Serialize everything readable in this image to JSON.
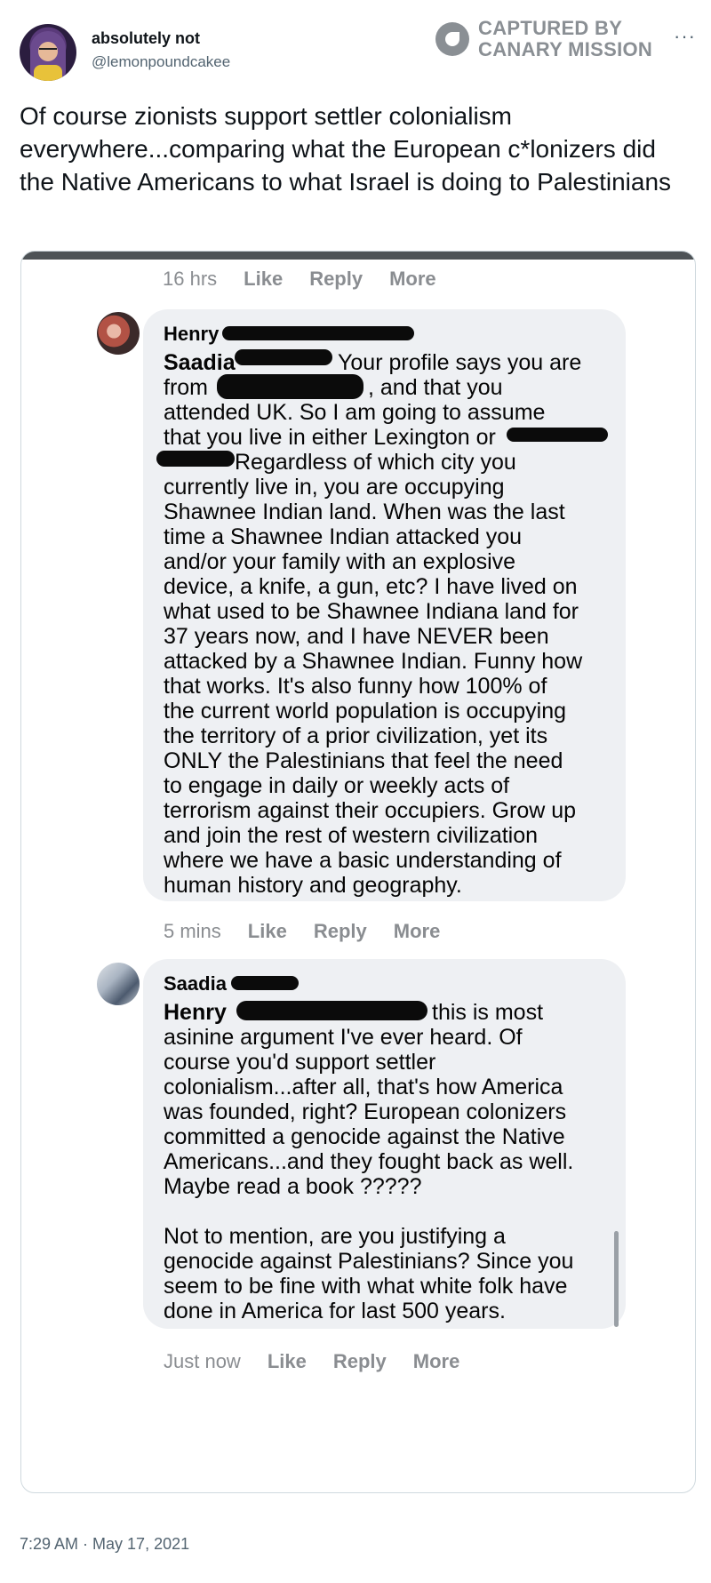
{
  "tweet": {
    "display_name": "absolutely not",
    "handle": "@lemonpoundcakee",
    "watermark": "CAPTURED BY\nCANARY MISSION",
    "watermark_line1": "CAPTURED BY",
    "watermark_line2": "CANARY MISSION",
    "more_icon": "more-dots-icon",
    "text": "Of course zionists support settler colonialism everywhere...comparing what the European c*lonizers did the Native Americans to what Israel is doing to Palestinians",
    "timestamp": "7:29 AM · May 17, 2021"
  },
  "embedded_thread": {
    "top_actions": {
      "time": "16 hrs",
      "like": "Like",
      "reply": "Reply",
      "more": "More"
    },
    "comments": [
      {
        "author": "Henry",
        "mention": "Saadia",
        "text_lines": [
          "Your profile says you are",
          "from",
          ", and that you",
          "attended UK. So I am going to assume",
          "that you live in either Lexington or",
          "Regardless of which city you",
          "currently live in, you are occupying",
          "Shawnee Indian land. When was the last",
          "time a Shawnee Indian attacked you",
          "and/or your family with an explosive",
          "device, a knife, a gun, etc? I have lived on",
          "what used to be Shawnee Indiana land for",
          "37 years now, and I have NEVER been",
          "attacked by a Shawnee Indian. Funny how",
          "that works. It's also funny how 100% of",
          "the current world population is occupying",
          "the territory of a prior civilization, yet its",
          "ONLY the Palestinians that feel the need",
          "to engage in daily or weekly acts of",
          "terrorism against their occupiers. Grow up",
          "and join the rest of western civilization",
          "where we have a basic understanding of",
          "human history and geography."
        ],
        "actions": {
          "time": "5 mins",
          "like": "Like",
          "reply": "Reply",
          "more": "More"
        }
      },
      {
        "author": "Saadia",
        "mention": "Henry",
        "text_lines": [
          "this is most",
          "asinine argument I've ever heard. Of",
          "course you'd support settler",
          "colonialism...after all, that's how America",
          "was founded, right? European colonizers",
          "committed a genocide against the Native",
          "Americans...and they fought back as well.",
          "Maybe read a book ?????",
          "Not to mention, are you justifying a",
          "genocide against Palestinians? Since you",
          "seem to be fine with what white folk have",
          "done in America for last 500 years."
        ],
        "actions": {
          "time": "Just now",
          "like": "Like",
          "reply": "Reply",
          "more": "More"
        }
      }
    ]
  }
}
